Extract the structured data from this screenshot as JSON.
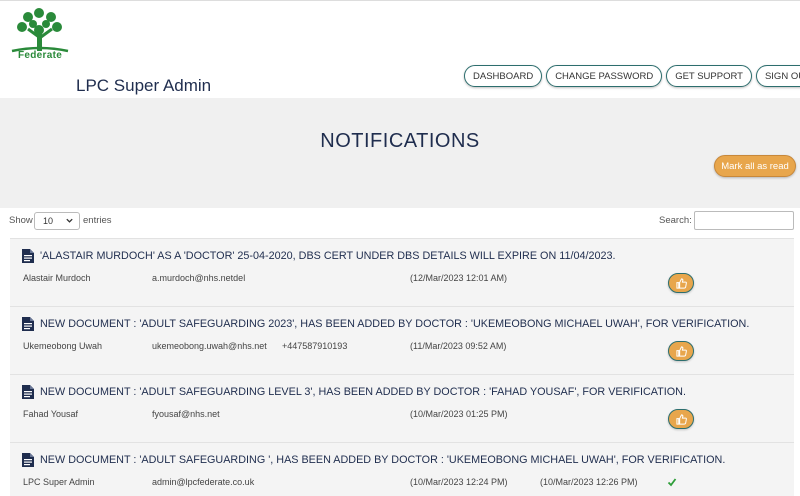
{
  "header": {
    "logo_text": "Federate",
    "app_title": "LPC Super Admin",
    "nav": [
      {
        "label": "DASHBOARD"
      },
      {
        "label": "CHANGE PASSWORD"
      },
      {
        "label": "GET SUPPORT"
      },
      {
        "label": "SIGN OUT"
      }
    ]
  },
  "banner": {
    "title": "NOTIFICATIONS",
    "mark_all_label": "Mark all as read"
  },
  "controls": {
    "show_label": "Show",
    "page_size": "10",
    "entries_label": "entries",
    "search_label": "Search:",
    "search_value": ""
  },
  "notifications": [
    {
      "title": "'ALASTAIR MURDOCH' AS A 'DOCTOR' 25-04-2020, DBS CERT UNDER DBS DETAILS WILL EXPIRE ON 11/04/2023.",
      "name": "Alastair Murdoch",
      "email": "a.murdoch@nhs.netdel",
      "phone": "",
      "created": "(12/Mar/2023 12:01 AM)",
      "read_at": "",
      "status": "unread"
    },
    {
      "title": "NEW DOCUMENT : 'ADULT SAFEGUARDING 2023', HAS BEEN ADDED BY DOCTOR : 'UKEMEOBONG MICHAEL UWAH', FOR VERIFICATION.",
      "name": "Ukemeobong Uwah",
      "email": "ukemeobong.uwah@nhs.net",
      "phone": "+447587910193",
      "created": "(11/Mar/2023 09:52 AM)",
      "read_at": "",
      "status": "unread"
    },
    {
      "title": "NEW DOCUMENT : 'ADULT SAFEGUARDING LEVEL 3', HAS BEEN ADDED BY DOCTOR : 'FAHAD YOUSAF', FOR VERIFICATION.",
      "name": "Fahad Yousaf",
      "email": "fyousaf@nhs.net",
      "phone": "",
      "created": "(10/Mar/2023 01:25 PM)",
      "read_at": "",
      "status": "unread"
    },
    {
      "title": "NEW DOCUMENT : 'ADULT SAFEGUARDING ', HAS BEEN ADDED BY DOCTOR : 'UKEMEOBONG MICHAEL UWAH', FOR VERIFICATION.",
      "name": "LPC Super Admin",
      "email": "admin@lpcfederate.co.uk",
      "phone": "",
      "created": "(10/Mar/2023 12:24 PM)",
      "read_at": "(10/Mar/2023 12:26 PM)",
      "status": "read"
    }
  ],
  "icons": {
    "document": "document-icon",
    "thumbs_up": "thumbs-up-icon",
    "check": "check-icon",
    "chevron": "chevron-down-icon",
    "logo": "tree-logo-icon"
  },
  "colors": {
    "brand_green": "#2a8a3a",
    "navy": "#1f2d4e",
    "accent_orange": "#e8a64c",
    "teal_border": "#2d6e6e"
  }
}
